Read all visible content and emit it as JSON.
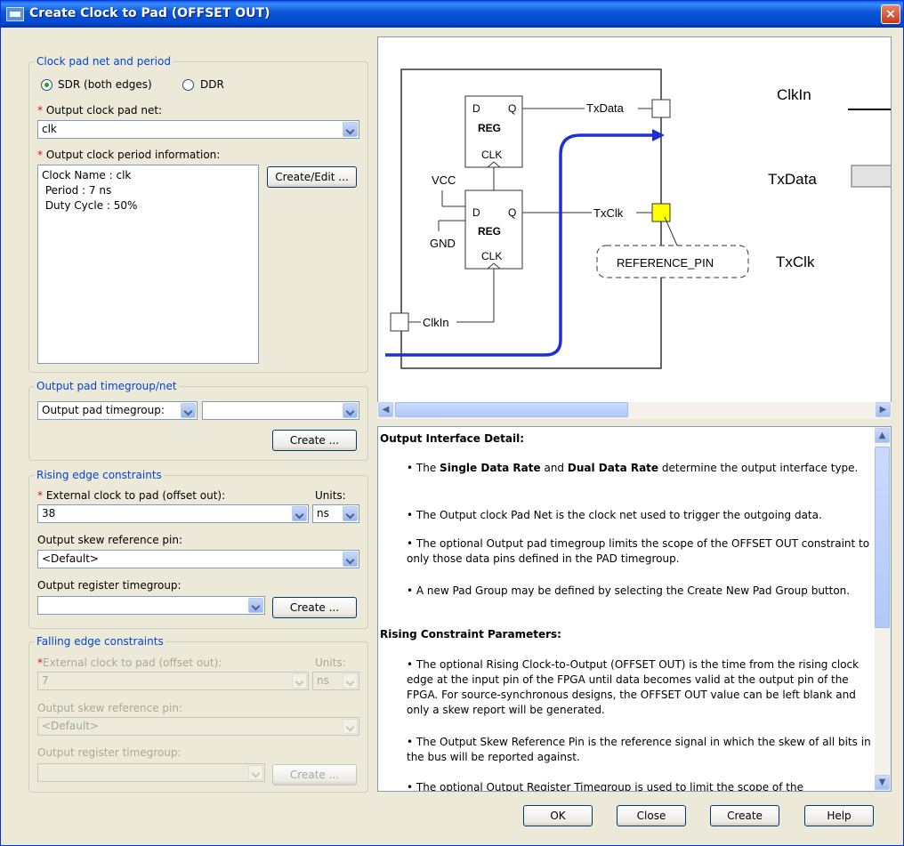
{
  "window": {
    "title": "Create Clock to Pad (OFFSET OUT)",
    "close_label": "×"
  },
  "clock_group": {
    "legend": "Clock pad net and period",
    "sdr_label": "SDR (both edges)",
    "ddr_label": "DDR",
    "selected_mode": "SDR",
    "net_label": "Output clock pad net:",
    "net_value": "clk",
    "period_label": "Output clock period information:",
    "period_lines": [
      "Clock Name : clk",
      " Period : 7 ns",
      " Duty Cycle : 50%"
    ],
    "create_edit_label": "Create/Edit ..."
  },
  "pad_group": {
    "legend": "Output pad timegroup/net",
    "type_value": "Output pad timegroup:",
    "name_value": "",
    "create_label": "Create ..."
  },
  "rising": {
    "legend": "Rising edge constraints",
    "ext_label": "External clock to pad (offset out):",
    "units_label": "Units:",
    "ext_value": "38",
    "units_value": "ns",
    "skew_label": "Output skew reference pin:",
    "skew_value": "<Default>",
    "reg_label": "Output register timegroup:",
    "reg_value": "",
    "create_label": "Create ..."
  },
  "falling": {
    "legend": "Falling edge constraints",
    "ext_label": "External clock to pad (offset out):",
    "units_label": "Units:",
    "ext_value": "7",
    "units_value": "ns",
    "skew_label": "Output skew reference pin:",
    "skew_value": "<Default>",
    "reg_label": "Output register timegroup:",
    "reg_value": "",
    "create_label": "Create ..."
  },
  "diagram": {
    "reg_d": "D",
    "reg_q": "Q",
    "reg_name": "REG",
    "reg_clk": "CLK",
    "txdata": "TxData",
    "txclk": "TxClk",
    "clkin": "ClkIn",
    "vcc": "VCC",
    "gnd": "GND",
    "ref_pin": "REFERENCE_PIN",
    "wave_clkin": "ClkIn",
    "wave_txdata": "TxData",
    "wave_txclk": "TxClk"
  },
  "detail": {
    "h1": "Output Interface Detail:",
    "b1_pre": "The ",
    "b1_bold1": "Single Data Rate",
    "b1_mid": " and ",
    "b1_bold2": "Dual Data Rate",
    "b1_post": " determine the output interface type.",
    "b2": "The Output clock Pad Net is the clock net used to trigger the outgoing data.",
    "b3": "The optional Output pad timegroup limits the scope of the OFFSET OUT constraint to only those data pins defined in the PAD timegroup.",
    "b4": "A new Pad Group may be defined by selecting the Create New Pad Group button.",
    "h2": "Rising Constraint Parameters:",
    "b5": "The optional Rising Clock-to-Output (OFFSET OUT) is the time from the rising clock edge at the input pin of the FPGA until data becomes valid at the output pin of the FPGA. For source-synchronous designs, the OFFSET OUT value can be left blank and only a skew report will be generated.",
    "b6": "The Output Skew Reference Pin is the reference signal in which the skew of all bits in the bus will be reported against.",
    "b7": "The optional Output Register Timegroup is used to limit the scope of the"
  },
  "footer": {
    "ok": "OK",
    "close": "Close",
    "create": "Create",
    "help": "Help"
  }
}
